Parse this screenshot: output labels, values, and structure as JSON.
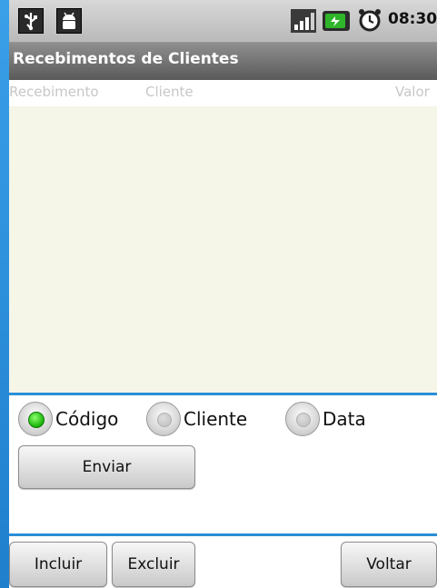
{
  "status_bar": {
    "time": "08:30",
    "icons": [
      "usb-icon",
      "android-debug-icon",
      "signal-icon",
      "battery-charging-icon",
      "alarm-clock-icon"
    ]
  },
  "title_bar": {
    "title": "Recebimentos de Clientes"
  },
  "list_header": {
    "columns": [
      "Recebimento",
      "Cliente",
      "Valor"
    ]
  },
  "radio_group": {
    "options": [
      {
        "label": "Código",
        "selected": true
      },
      {
        "label": "Cliente",
        "selected": false
      },
      {
        "label": "Data",
        "selected": false
      }
    ]
  },
  "buttons": {
    "enviar": "Enviar",
    "incluir": "Incluir",
    "excluir": "Excluir",
    "voltar": "Voltar"
  },
  "colors": {
    "accent_divider": "#2b8fd6",
    "list_background": "#f5f5e8",
    "radio_selected": "#1fb80f"
  }
}
